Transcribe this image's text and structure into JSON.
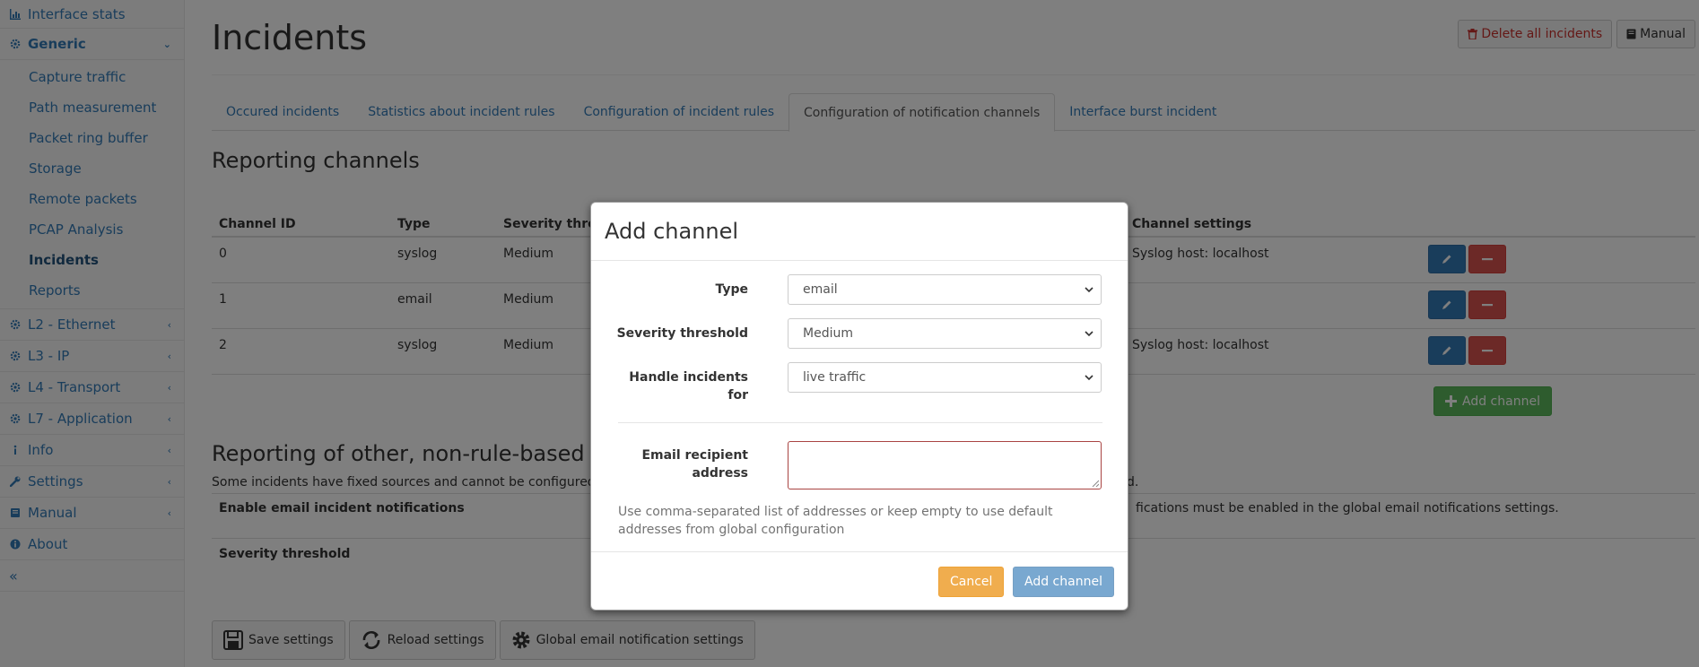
{
  "sidebar": {
    "items": [
      {
        "label": "Interface stats",
        "icon": "bar-chart-icon"
      },
      {
        "label": "Generic",
        "icon": "gear-icon"
      },
      {
        "label": "L2 - Ethernet",
        "icon": "gear-icon"
      },
      {
        "label": "L3 - IP",
        "icon": "gear-icon"
      },
      {
        "label": "L4 - Transport",
        "icon": "gear-icon"
      },
      {
        "label": "L7 - Application",
        "icon": "gear-icon"
      },
      {
        "label": "Info",
        "icon": "info-icon"
      },
      {
        "label": "Settings",
        "icon": "wrench-icon"
      },
      {
        "label": "Manual",
        "icon": "book-icon"
      },
      {
        "label": "About",
        "icon": "info-circle-icon"
      }
    ],
    "generic_sub": [
      "Capture traffic",
      "Path measurement",
      "Packet ring buffer",
      "Storage",
      "Remote packets",
      "PCAP Analysis",
      "Incidents",
      "Reports"
    ],
    "active_sub": "Incidents",
    "collapse_glyph": "«"
  },
  "header": {
    "title": "Incidents",
    "delete_all_label": "Delete all incidents",
    "manual_label": "Manual"
  },
  "tabs": [
    {
      "label": "Occured incidents"
    },
    {
      "label": "Statistics about incident rules"
    },
    {
      "label": "Configuration of incident rules"
    },
    {
      "label": "Configuration of notification channels",
      "active": true
    },
    {
      "label": "Interface burst incident"
    }
  ],
  "reporting": {
    "title": "Reporting channels",
    "columns": [
      "Channel ID",
      "Type",
      "Severity thre",
      "Channel settings"
    ],
    "rows": [
      {
        "id": "0",
        "type": "syslog",
        "severity": "Medium",
        "settings": "Syslog host: localhost"
      },
      {
        "id": "1",
        "type": "email",
        "severity": "Medium",
        "settings": ""
      },
      {
        "id": "2",
        "type": "syslog",
        "severity": "Medium",
        "settings": "Syslog host: localhost"
      }
    ],
    "add_channel_label": "Add channel"
  },
  "other": {
    "title": "Reporting of other, non-rule-based",
    "description_left": "Some incidents have fixed sources and cannot be configured",
    "description_right": "d.",
    "enable_email_label": "Enable email incident notifications",
    "enable_email_note": "fications must be enabled in the global email notifications settings.",
    "severity_label": "Severity threshold"
  },
  "bottom_buttons": {
    "save": "Save settings",
    "reload": "Reload settings",
    "global_email": "Global email notification settings"
  },
  "modal": {
    "title": "Add channel",
    "type_label": "Type",
    "type_value": "email",
    "severity_label": "Severity threshold",
    "severity_value": "Medium",
    "handle_label_1": "Handle incidents",
    "handle_label_2": "for",
    "handle_value": "live traffic",
    "email_label_1": "Email recipient",
    "email_label_2": "address",
    "email_value": "",
    "help_text": "Use comma-separated list of addresses or keep empty to use default addresses from global configuration",
    "cancel_label": "Cancel",
    "add_label": "Add channel"
  },
  "colors": {
    "link": "#337ab7",
    "danger": "#d9534f",
    "success": "#5cb85c",
    "warning": "#f0ad4e",
    "error_border": "#a94442"
  }
}
